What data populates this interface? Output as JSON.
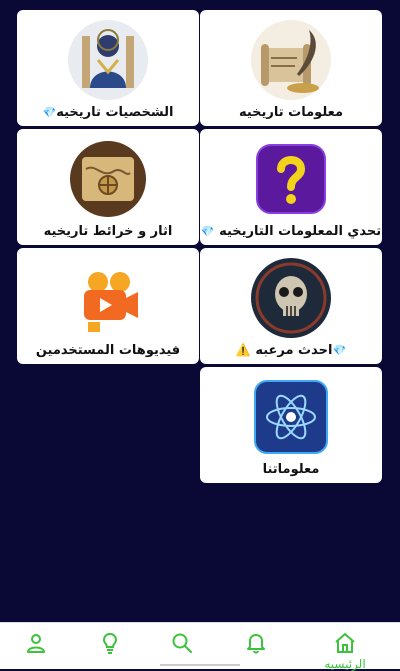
{
  "grid": {
    "cards": [
      {
        "label": "معلومات تاريخيه",
        "icon": "scroll-quill-icon"
      },
      {
        "label": "الشخصيات تاريخيه",
        "icon": "historical-figure-icon",
        "badge": "💎"
      },
      {
        "label": "تحدي المعلومات التاريخيه",
        "icon": "question-mark-icon",
        "badge": "💎"
      },
      {
        "label": "اثار و خرائط تاريخيه",
        "icon": "ancient-map-icon"
      },
      {
        "label": "احدث مرعبه",
        "icon": "skull-icon",
        "badge": "💎",
        "warning": "⚠️"
      },
      {
        "label": "فيديوهات المستخدمين",
        "icon": "video-camera-icon"
      },
      {
        "label": "معلوماتنا",
        "icon": "atom-icon"
      }
    ]
  },
  "bottom_nav": {
    "items": [
      {
        "label": "الرئيسيه",
        "icon": "home-icon",
        "active": true
      },
      {
        "label": "",
        "icon": "bell-icon"
      },
      {
        "label": "",
        "icon": "search-icon"
      },
      {
        "label": "",
        "icon": "lightbulb-icon"
      },
      {
        "label": "",
        "icon": "person-icon"
      }
    ]
  },
  "colors": {
    "background": "#0a0835",
    "card": "#ffffff",
    "accent_green": "#3cc23c",
    "gem": "#22b8e0"
  }
}
